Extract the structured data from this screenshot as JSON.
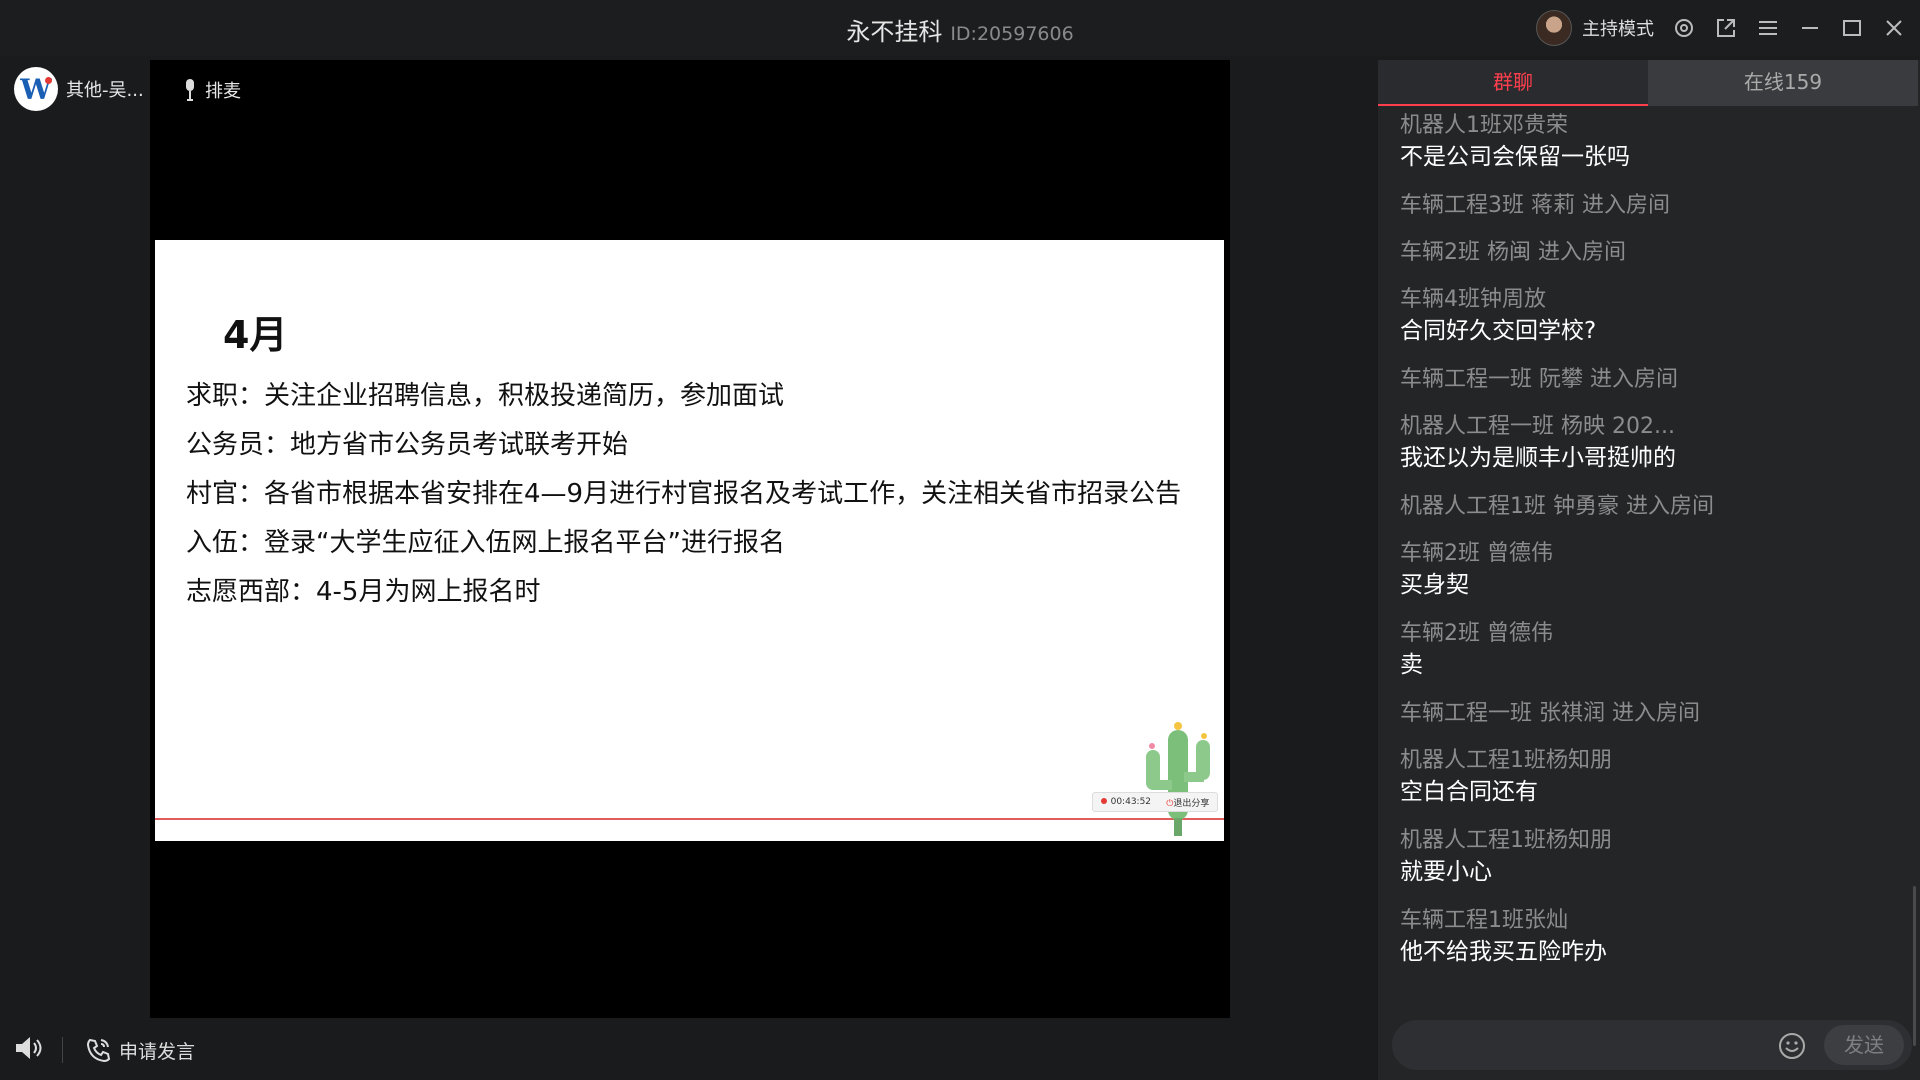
{
  "window": {
    "title": "永不挂科",
    "room_id": "ID:20597606",
    "host_mode_label": "主持模式",
    "icons": [
      "settings-icon",
      "popout-icon",
      "menu-icon",
      "minimize-icon",
      "maximize-icon",
      "close-icon"
    ]
  },
  "presenter": {
    "name": "其他-吴...",
    "queue_mic_label": "排麦"
  },
  "slide": {
    "month": "4月",
    "lines": [
      "求职：关注企业招聘信息，积极投递简历，参加面试",
      "公务员：地方省市公务员考试联考开始",
      "村官：各省市根据本省安排在4—9月进行村官报名及考试工作，关注相关省市招录公告",
      "入伍：登录“大学生应征入伍网上报名平台”进行报名",
      "志愿西部：4-5月为网上报名时"
    ],
    "record_time": "00:43:52",
    "exit_share_label": "退出分享"
  },
  "bottom": {
    "apply_speak_label": "申请发言"
  },
  "chat": {
    "tabs": {
      "group": "群聊",
      "online": "在线159"
    },
    "messages": [
      {
        "name": "机器人1班邓贵荣",
        "text": "不是公司会保留一张吗"
      },
      {
        "name": "车辆工程3班 蒋莉 进入房间",
        "text": ""
      },
      {
        "name": "车辆2班  杨闽 进入房间",
        "text": ""
      },
      {
        "name": "车辆4班钟周放",
        "text": "合同好久交回学校?"
      },
      {
        "name": "车辆工程一班 阮攀 进入房间",
        "text": ""
      },
      {
        "name": "机器人工程一班 杨映 202...",
        "text": "我还以为是顺丰小哥挺帅的"
      },
      {
        "name": "机器人工程1班 钟勇豪 进入房间",
        "text": ""
      },
      {
        "name": "车辆2班  曾德伟",
        "text": "买身契"
      },
      {
        "name": "车辆2班  曾德伟",
        "text": "卖"
      },
      {
        "name": "车辆工程一班 张祺润 进入房间",
        "text": ""
      },
      {
        "name": "机器人工程1班杨知朋",
        "text": "空白合同还有"
      },
      {
        "name": "机器人工程1班杨知朋",
        "text": "就要小心"
      },
      {
        "name": "车辆工程1班张灿",
        "text": "他不给我买五险咋办"
      }
    ],
    "send_label": "发送",
    "input_value": ""
  },
  "colors": {
    "accent": "#ff3f4e",
    "background": "#1a1b1d",
    "panel": "#242527"
  }
}
